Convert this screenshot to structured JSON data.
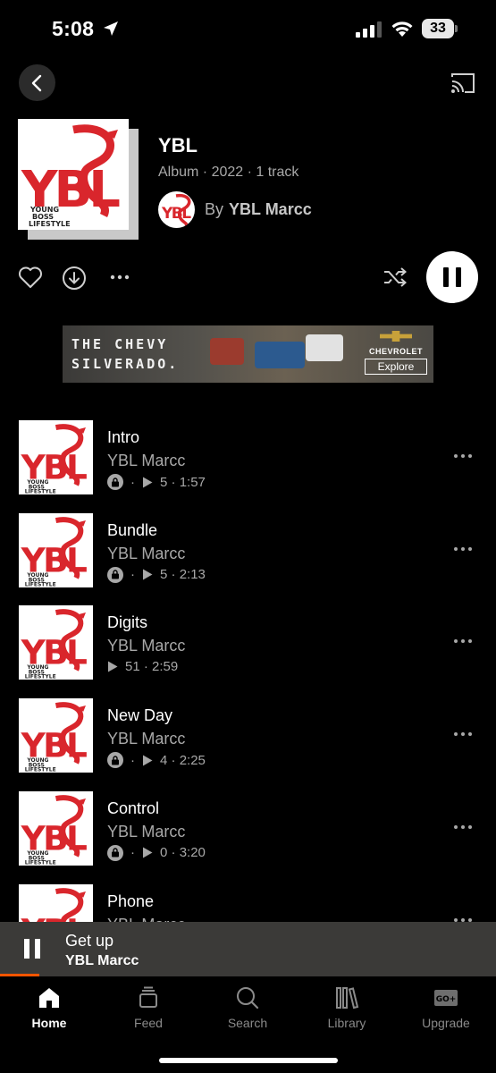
{
  "status_bar": {
    "time": "5:08",
    "battery": "33",
    "icons": [
      "location-arrow-icon",
      "signal-icon",
      "wifi-icon",
      "battery-icon"
    ]
  },
  "nav": {
    "back_icon": "chevron-left-icon",
    "cast_icon": "cast-icon"
  },
  "album": {
    "title": "YBL",
    "meta": "Album · 2022 · 1 track",
    "by_label": "By",
    "artist": "YBL Marcc",
    "art_text": "YBL",
    "art_subtext": "YOUNG BOSS LIFESTYLE"
  },
  "actions": {
    "icons": [
      "heart-icon",
      "download-icon",
      "more-horizontal-icon",
      "shuffle-icon",
      "pause-icon"
    ]
  },
  "ad": {
    "line1": "THE CHEVY",
    "line2": "SILVERADO.",
    "brand": "CHEVROLET",
    "cta": "Explore"
  },
  "tracks": [
    {
      "title": "Intro",
      "artist": "YBL Marcc",
      "locked": true,
      "plays": "5",
      "duration": "1:57"
    },
    {
      "title": "Bundle",
      "artist": "YBL Marcc",
      "locked": true,
      "plays": "5",
      "duration": "2:13"
    },
    {
      "title": "Digits",
      "artist": "YBL Marcc",
      "locked": false,
      "plays": "51",
      "duration": "2:59"
    },
    {
      "title": "New Day",
      "artist": "YBL Marcc",
      "locked": true,
      "plays": "4",
      "duration": "2:25"
    },
    {
      "title": "Control",
      "artist": "YBL Marcc",
      "locked": true,
      "plays": "0",
      "duration": "3:20"
    },
    {
      "title": "Phone",
      "artist": "YBL Marcc",
      "locked": true,
      "plays": "",
      "duration": ""
    }
  ],
  "now_playing": {
    "title": "Get up",
    "artist": "YBL Marcc",
    "progress": 0.08
  },
  "tabs": [
    {
      "label": "Home",
      "icon": "home-icon",
      "active": true
    },
    {
      "label": "Feed",
      "icon": "feed-icon",
      "active": false
    },
    {
      "label": "Search",
      "icon": "search-icon",
      "active": false
    },
    {
      "label": "Library",
      "icon": "library-icon",
      "active": false
    },
    {
      "label": "Upgrade",
      "icon": "go-plus-icon",
      "active": false
    }
  ],
  "colors": {
    "accent": "#ff5500",
    "art_red": "#d9262c"
  }
}
